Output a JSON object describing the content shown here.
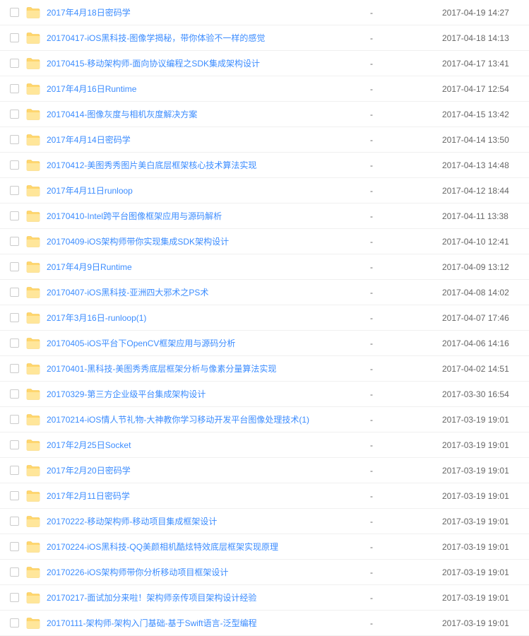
{
  "files": [
    {
      "name": "2017年4月18日密码学",
      "size": "-",
      "date": "2017-04-19 14:27"
    },
    {
      "name": "20170417-iOS黑科技-图像学揭秘，带你体验不一样的感觉",
      "size": "-",
      "date": "2017-04-18 14:13"
    },
    {
      "name": "20170415-移动架构师-面向协议编程之SDK集成架构设计",
      "size": "-",
      "date": "2017-04-17 13:41"
    },
    {
      "name": "2017年4月16日Runtime",
      "size": "-",
      "date": "2017-04-17 12:54"
    },
    {
      "name": "20170414-图像灰度与相机灰度解决方案",
      "size": "-",
      "date": "2017-04-15 13:42"
    },
    {
      "name": "2017年4月14日密码学",
      "size": "-",
      "date": "2017-04-14 13:50"
    },
    {
      "name": "20170412-美图秀秀图片美白底层框架核心技术算法实现",
      "size": "-",
      "date": "2017-04-13 14:48"
    },
    {
      "name": "2017年4月11日runloop",
      "size": "-",
      "date": "2017-04-12 18:44"
    },
    {
      "name": "20170410-Intel跨平台图像框架应用与源码解析",
      "size": "-",
      "date": "2017-04-11 13:38"
    },
    {
      "name": "20170409-iOS架构师带你实现集成SDK架构设计",
      "size": "-",
      "date": "2017-04-10 12:41"
    },
    {
      "name": "2017年4月9日Runtime",
      "size": "-",
      "date": "2017-04-09 13:12"
    },
    {
      "name": "20170407-iOS黑科技-亚洲四大邪术之PS术",
      "size": "-",
      "date": "2017-04-08 14:02"
    },
    {
      "name": "2017年3月16日-runloop(1)",
      "size": "-",
      "date": "2017-04-07 17:46"
    },
    {
      "name": "20170405-iOS平台下OpenCV框架应用与源码分析",
      "size": "-",
      "date": "2017-04-06 14:16"
    },
    {
      "name": "20170401-黑科技-美图秀秀底层框架分析与像素分量算法实现",
      "size": "-",
      "date": "2017-04-02 14:51"
    },
    {
      "name": "20170329-第三方企业级平台集成架构设计",
      "size": "-",
      "date": "2017-03-30 16:54"
    },
    {
      "name": "20170214-iOS情人节礼物-大神教你学习移动开发平台图像处理技术(1)",
      "size": "-",
      "date": "2017-03-19 19:01"
    },
    {
      "name": "2017年2月25日Socket",
      "size": "-",
      "date": "2017-03-19 19:01"
    },
    {
      "name": "2017年2月20日密码学",
      "size": "-",
      "date": "2017-03-19 19:01"
    },
    {
      "name": "2017年2月11日密码学",
      "size": "-",
      "date": "2017-03-19 19:01"
    },
    {
      "name": "20170222-移动架构师-移动项目集成框架设计",
      "size": "-",
      "date": "2017-03-19 19:01"
    },
    {
      "name": "20170224-iOS黑科技-QQ美颜相机酷炫特效底层框架实现原理",
      "size": "-",
      "date": "2017-03-19 19:01"
    },
    {
      "name": "20170226-iOS架构师带你分析移动项目框架设计",
      "size": "-",
      "date": "2017-03-19 19:01"
    },
    {
      "name": "20170217-面试加分来啦！架构师亲传项目架构设计经验",
      "size": "-",
      "date": "2017-03-19 19:01"
    },
    {
      "name": "20170111-架构师-架构入门基础-基于Swift语言-泛型编程",
      "size": "-",
      "date": "2017-03-19 19:01"
    }
  ]
}
